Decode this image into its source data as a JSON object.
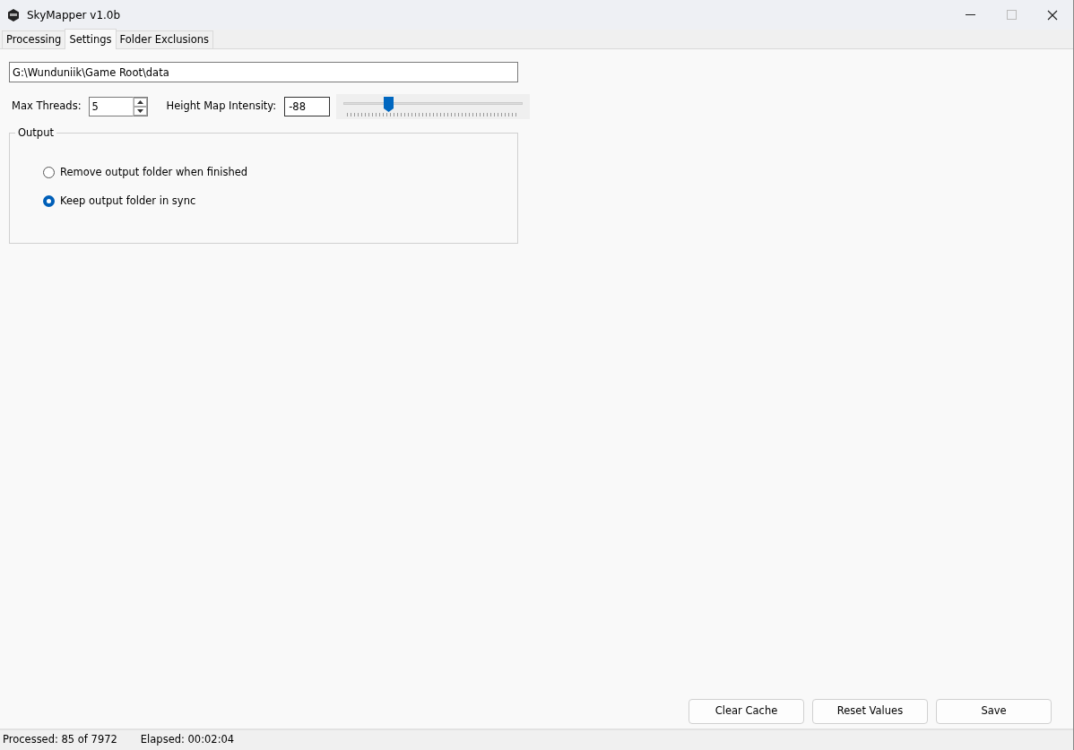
{
  "window": {
    "title": "SkyMapper v1.0b"
  },
  "tabs": [
    {
      "label": "Processing",
      "selected": false
    },
    {
      "label": "Settings",
      "selected": true
    },
    {
      "label": "Folder Exclusions",
      "selected": false
    }
  ],
  "path_field": {
    "value": "G:\\Wunduniik\\Game Root\\data"
  },
  "max_threads": {
    "label": "Max Threads:",
    "value": "5"
  },
  "height_map": {
    "label": "Height Map Intensity:",
    "value": "-88",
    "level": 0.25
  },
  "output": {
    "title": "Output",
    "options": [
      {
        "label": "Remove output folder when finished",
        "selected": false
      },
      {
        "label": "Keep output folder in sync",
        "selected": true
      }
    ]
  },
  "buttons": [
    "Clear Cache",
    "Reset Values",
    "Save"
  ],
  "status_bar": [
    "Processed: 85 of 7972",
    "Elapsed: 00:02:04"
  ]
}
